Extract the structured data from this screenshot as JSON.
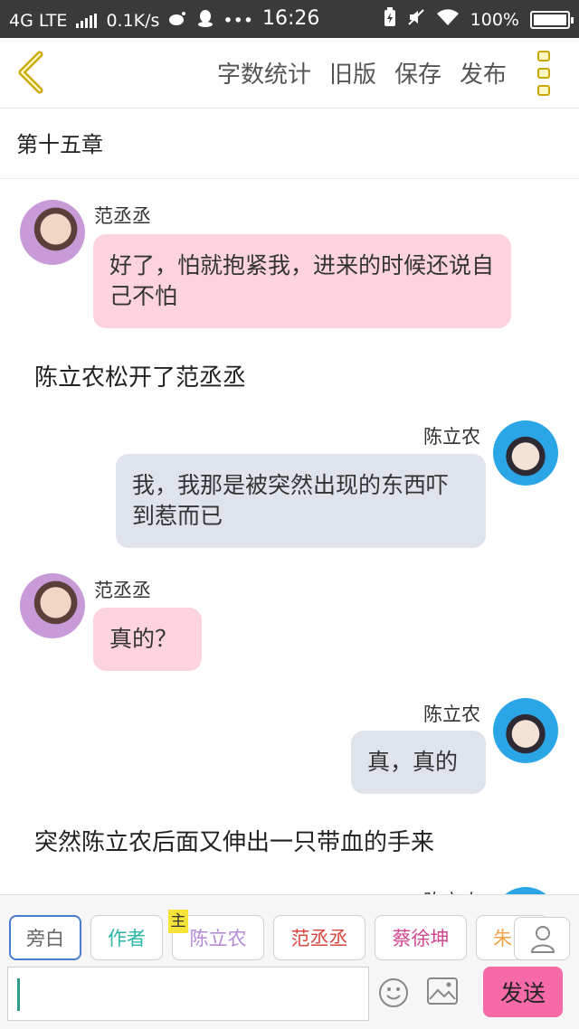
{
  "status_bar": {
    "network": "4G LTE",
    "speed": "0.1K/s",
    "time": "16:26",
    "battery": "100%",
    "overflow": "•••"
  },
  "header": {
    "actions": [
      "字数统计",
      "旧版",
      "保存",
      "发布"
    ]
  },
  "chapter": {
    "title": "第十五章"
  },
  "messages": [
    {
      "type": "left",
      "name": "范丞丞",
      "text": "好了，怕就抱紧我，进来的时候还说自己不怕"
    },
    {
      "type": "narration",
      "text": "陈立农松开了范丞丞"
    },
    {
      "type": "right",
      "name": "陈立农",
      "text": "我，我那是被突然出现的东西吓到惹而已"
    },
    {
      "type": "left",
      "name": "范丞丞",
      "text": "真的？"
    },
    {
      "type": "right",
      "name": "陈立农",
      "text": "真，真的"
    },
    {
      "type": "narration",
      "text": "突然陈立农后面又伸出一只带血的手来"
    },
    {
      "type": "right-partial",
      "name": "陈立农"
    }
  ],
  "role_tags": [
    {
      "label": "旁白",
      "color": "#666666"
    },
    {
      "label": "作者",
      "color": "#2bb5a6"
    },
    {
      "label": "陈立农",
      "color": "#b58ad8",
      "badge": "主"
    },
    {
      "label": "范丞丞",
      "color": "#d8463e"
    },
    {
      "label": "蔡徐坤",
      "color": "#d0458e"
    },
    {
      "label": "朱",
      "color": "#f0a24a"
    }
  ],
  "input": {
    "value": ""
  },
  "send_label": "发送",
  "colors": {
    "pink_bubble": "#fdd4dd",
    "gray_bubble": "#dfe4ec",
    "send": "#f56aa7"
  }
}
